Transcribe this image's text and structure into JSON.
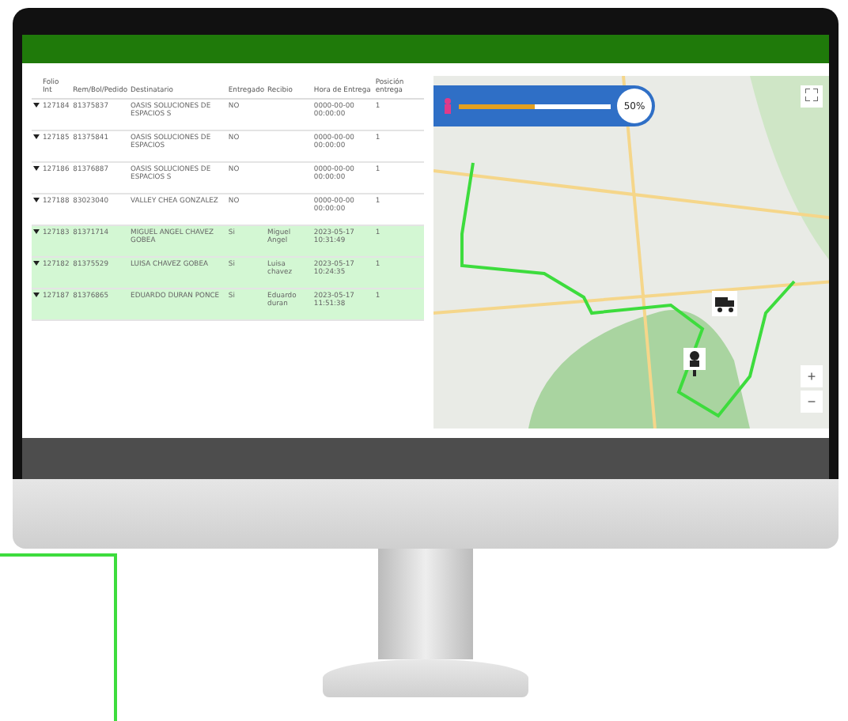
{
  "table": {
    "columns": [
      "Folio Int",
      "Rem/Bol/Pedido",
      "Destinatario",
      "Entregado",
      "Recibio",
      "Hora de Entrega",
      "Posición entrega"
    ],
    "rows": [
      {
        "expanded": false,
        "highlighted": false,
        "cells": [
          "127184",
          "81375837",
          "OASIS SOLUCIONES DE ESPACIOS S",
          "NO",
          "",
          "0000-00-00 00:00:00",
          "1"
        ]
      },
      {
        "expanded": false,
        "highlighted": false,
        "cells": [
          "127185",
          "81375841",
          "OASIS SOLUCIONES DE ESPACIOS",
          "NO",
          "",
          "0000-00-00 00:00:00",
          "1"
        ]
      },
      {
        "expanded": false,
        "highlighted": false,
        "cells": [
          "127186",
          "81376887",
          "OASIS SOLUCIONES DE ESPACIOS S",
          "NO",
          "",
          "0000-00-00 00:00:00",
          "1"
        ]
      },
      {
        "expanded": false,
        "highlighted": false,
        "cells": [
          "127188",
          "83023040",
          "VALLEY CHEA GONZALEZ",
          "NO",
          "",
          "0000-00-00 00:00:00",
          "1"
        ]
      },
      {
        "expanded": false,
        "highlighted": true,
        "cells": [
          "127183",
          "81371714",
          "MIGUEL ANGEL CHAVEZ GOBEA",
          "Si",
          "Miguel Angel",
          "2023-05-17 10:31:49",
          "1"
        ]
      },
      {
        "expanded": false,
        "highlighted": true,
        "cells": [
          "127182",
          "81375529",
          "LUISA CHAVEZ GOBEA",
          "Si",
          "Luisa chavez",
          "2023-05-17 10:24:35",
          "1"
        ]
      },
      {
        "expanded": false,
        "highlighted": true,
        "cells": [
          "127187",
          "81376865",
          "EDUARDO DURAN PONCE",
          "Si",
          "Eduardo duran",
          "2023-05-17 11:51:38",
          "1"
        ]
      }
    ]
  },
  "map": {
    "progress": {
      "level": 0.5,
      "reading": "50%"
    },
    "zoom_in": "+",
    "zoom_out": "−"
  }
}
